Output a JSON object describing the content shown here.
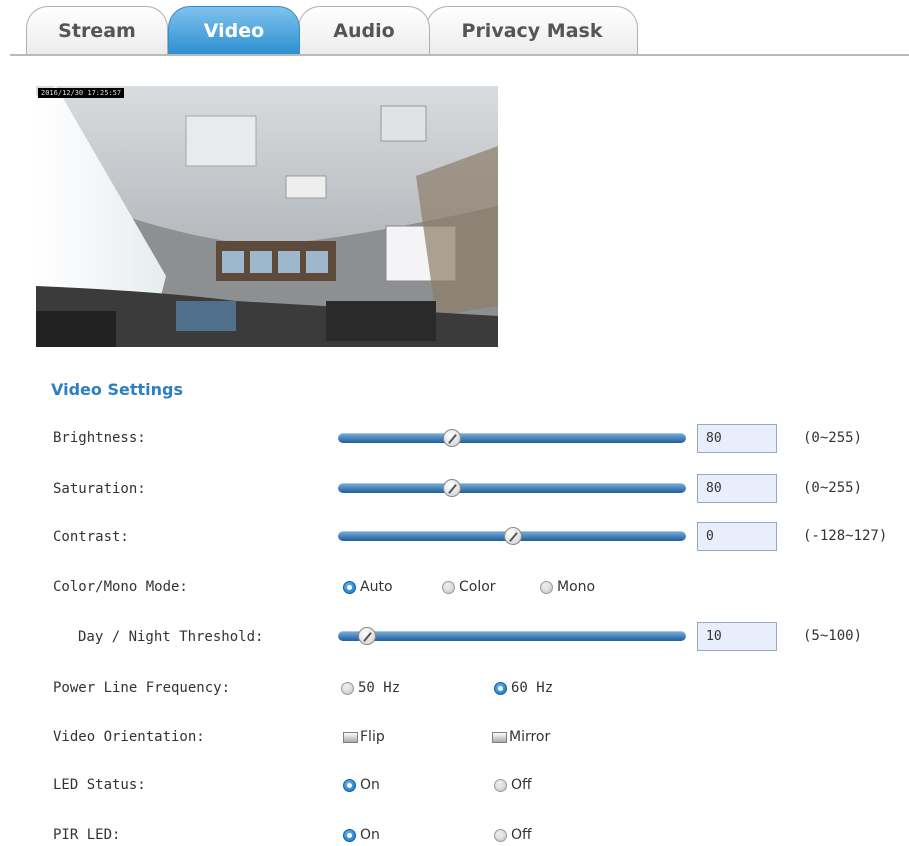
{
  "tabs": [
    {
      "label": "Stream",
      "active": false
    },
    {
      "label": "Video",
      "active": true
    },
    {
      "label": "Audio",
      "active": false
    },
    {
      "label": "Privacy Mask",
      "active": false
    }
  ],
  "preview": {
    "timestamp": "2016/12/30 17:25:57"
  },
  "video_settings": {
    "title": "Video Settings",
    "brightness": {
      "label": "Brightness:",
      "value": "80",
      "range": "(0~255)",
      "min": 0,
      "max": 255
    },
    "saturation": {
      "label": "Saturation:",
      "value": "80",
      "range": "(0~255)",
      "min": 0,
      "max": 255
    },
    "contrast": {
      "label": "Contrast:",
      "value": "0",
      "range": "(-128~127)",
      "min": -128,
      "max": 127
    },
    "color_mode": {
      "label": "Color/Mono Mode:",
      "options": [
        "Auto",
        "Color",
        "Mono"
      ],
      "selected": "Auto"
    },
    "threshold": {
      "label": "Day / Night Threshold:",
      "value": "10",
      "range": "(5~100)",
      "min": 5,
      "max": 100
    },
    "power_line": {
      "label": "Power Line Frequency:",
      "options": [
        "50 Hz",
        "60 Hz"
      ],
      "selected": "60 Hz"
    },
    "orientation": {
      "label": "Video Orientation:",
      "flip": "Flip",
      "mirror": "Mirror",
      "flip_checked": false,
      "mirror_checked": false
    },
    "led_status": {
      "label": "LED Status:",
      "options": [
        "On",
        "Off"
      ],
      "selected": "On"
    },
    "pir_led": {
      "label": "PIR LED:",
      "options": [
        "On",
        "Off"
      ],
      "selected": "On"
    }
  },
  "colors": {
    "accent": "#2c7fc2",
    "tab_active": "#2d8fd0",
    "input_bg": "#e8eefc"
  }
}
